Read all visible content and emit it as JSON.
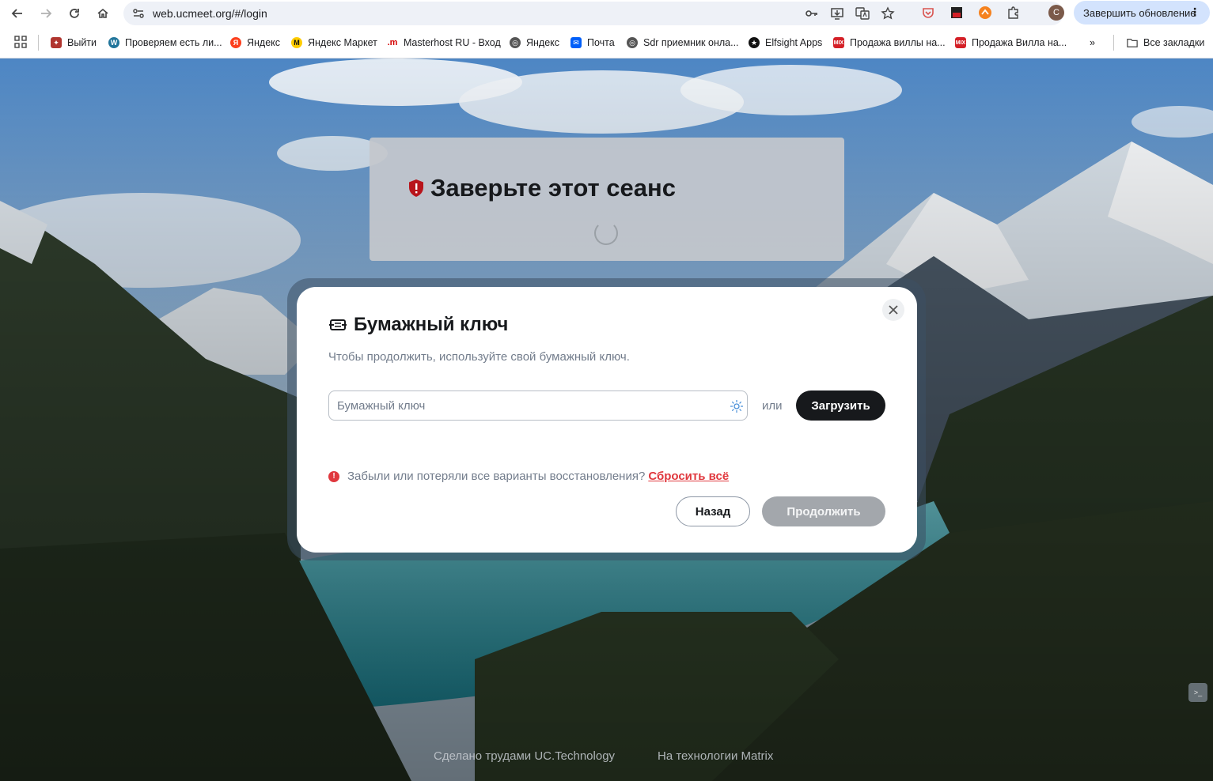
{
  "browser": {
    "url": "web.ucmeet.org/#/login",
    "avatar_letter": "C",
    "update_button": "Завершить обновление",
    "all_bookmarks": "Все закладки"
  },
  "bookmarks": [
    {
      "label": "Выйти",
      "color": "#b0352f"
    },
    {
      "label": "Проверяем есть ли...",
      "color": "#21759b"
    },
    {
      "label": "Яндекс",
      "color": "#fc3f1d"
    },
    {
      "label": "Яндекс Маркет",
      "color": "#ffcc00"
    },
    {
      "label": "Masterhost RU - Вход",
      "color": "#d40000"
    },
    {
      "label": "Яндекс",
      "color": "#555555"
    },
    {
      "label": "Почта",
      "color": "#005ff9"
    },
    {
      "label": "Sdr приемник онла...",
      "color": "#555555"
    },
    {
      "label": "Elfsight Apps",
      "color": "#111111"
    },
    {
      "label": "Продажа виллы на...",
      "color": "#d42027"
    },
    {
      "label": "Продажа Вилла на...",
      "color": "#d42027"
    }
  ],
  "verify": {
    "title": "Заверьте этот сеанс"
  },
  "dialog": {
    "title": "Бумажный ключ",
    "subtitle": "Чтобы продолжить, используйте свой бумажный ключ.",
    "key_placeholder": "Бумажный ключ",
    "or_label": "или",
    "upload_label": "Загрузить",
    "forgot_text": "Забыли или потеряли все варианты восстановления?",
    "reset_label": "Сбросить всё",
    "back_label": "Назад",
    "continue_label": "Продолжить"
  },
  "footer": {
    "made_by": "Сделано трудами UC.Technology",
    "powered_by": "На технологии Matrix"
  },
  "colors": {
    "accent_dark": "#17191c",
    "danger": "#e0383e",
    "muted_text": "#737d8c",
    "disabled_button": "#a3a7ac"
  }
}
